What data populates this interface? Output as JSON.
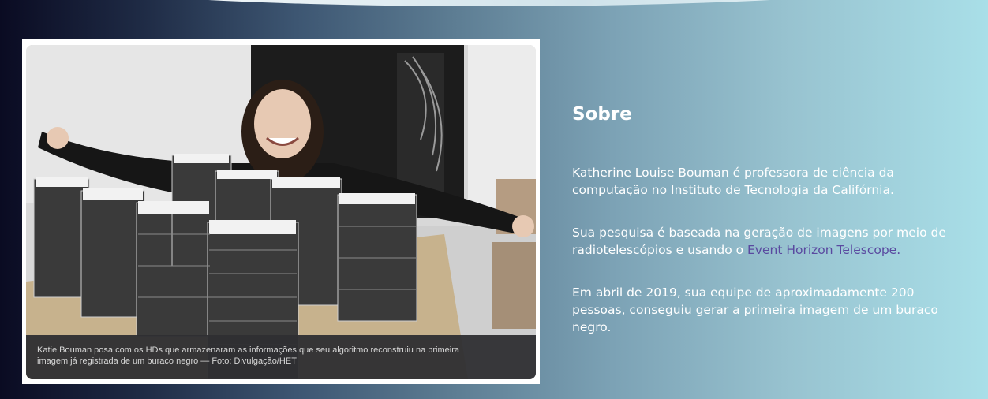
{
  "page": {
    "accent_color": "#5a4aa0",
    "background_start": "#0a0b22",
    "background_end": "#a9dfe8"
  },
  "photo": {
    "description_icon": "photo-researcher-with-hard-drives",
    "caption_line1": "Katie Bouman posa com os HDs que armazenaram as informações que seu algoritmo reconstruiu na primeira",
    "caption_line2": "imagem já registrada de um buraco negro — Foto: Divulgação/HET"
  },
  "about": {
    "title": "Sobre",
    "paragraph1": "Katherine Louise Bouman é professora de ciência da computação no Instituto de Tecnologia da Califórnia.",
    "paragraph2_text": "Sua pesquisa é baseada na geração de imagens por meio de radiotelescópios e usando o ",
    "paragraph2_link": "Event Horizon Telescope.",
    "paragraph3": "Em abril de 2019, sua equipe de aproximadamente 200 pessoas, conseguiu gerar a primeira imagem de um buraco negro."
  }
}
